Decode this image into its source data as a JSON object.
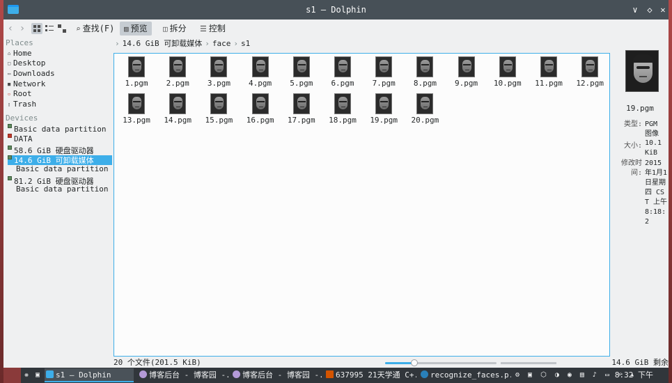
{
  "window": {
    "title": "s1 — Dolphin",
    "controls": {
      "minimize": "∨",
      "keep_above": "◇",
      "close": "✕"
    }
  },
  "toolbar": {
    "back": "‹",
    "forward": "›",
    "find": "查找(F)",
    "preview": "预览",
    "split": "拆分",
    "control": "控制",
    "preview_active": true
  },
  "sidebar": {
    "places_header": "Places",
    "places": [
      "Home",
      "Desktop",
      "Downloads",
      "Network",
      "Root",
      "Trash"
    ],
    "devices_header": "Devices",
    "devices": [
      {
        "label": "Basic data partition"
      },
      {
        "label": "DATA"
      },
      {
        "label": "58.6 GiB 硬盘驱动器",
        "sub": ""
      },
      {
        "label": "14.6 GiB 可卸载媒体",
        "sub": "Basic data partition",
        "selected": true
      },
      {
        "label": "81.2 GiB 硬盘驱动器",
        "sub": "Basic data partition"
      }
    ]
  },
  "breadcrumb": [
    "14.6 GiB 可卸载媒体",
    "face",
    "s1"
  ],
  "files": [
    "1.pgm",
    "2.pgm",
    "3.pgm",
    "4.pgm",
    "5.pgm",
    "6.pgm",
    "7.pgm",
    "8.pgm",
    "9.pgm",
    "10.pgm",
    "11.pgm",
    "12.pgm",
    "13.pgm",
    "14.pgm",
    "15.pgm",
    "16.pgm",
    "17.pgm",
    "18.pgm",
    "19.pgm",
    "20.pgm"
  ],
  "info_panel": {
    "filename": "19.pgm",
    "type_label": "类型:",
    "type_value": "PGM 图像",
    "size_label": "大小:",
    "size_value": "10.1 KiB",
    "mtime_label": "修改时间:",
    "mtime_value": "2015年1月1日星期四 CST 上午 8:18:2"
  },
  "status": {
    "summary": "20 个文件(201.5 KiB)",
    "free_space": "14.6 GiB 剩余"
  },
  "taskbar": {
    "tasks": [
      "s1 — Dolphin",
      "博客后台 - 博客园 -...",
      "博客后台 - 博客园 -...",
      "637995 21天学通 C+...",
      "recognize_faces.p..."
    ],
    "tray_icons": "⚙ ▣ ⬡ ◑ ◉ ▤ ♪ ▭ ⚡ ▴",
    "clock": "8:32 下午"
  }
}
